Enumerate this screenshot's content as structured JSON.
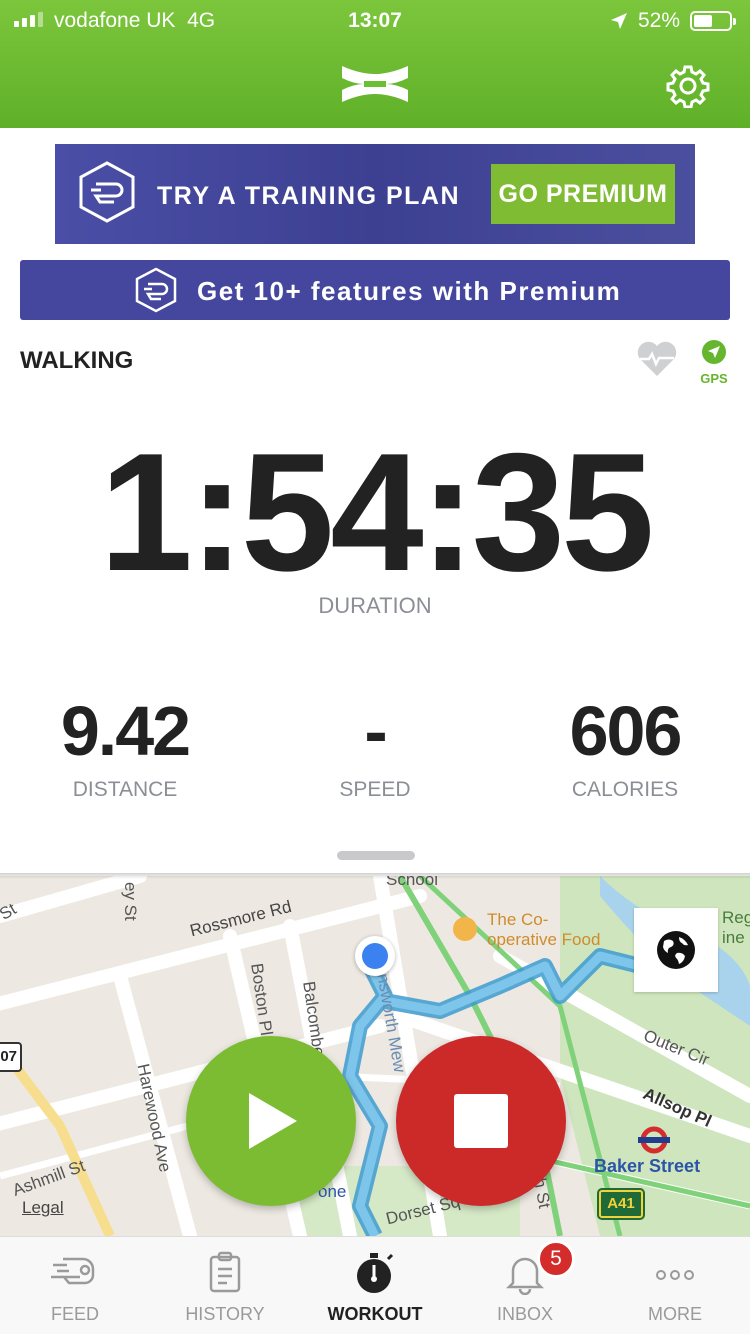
{
  "status_bar": {
    "carrier": "vodafone UK",
    "network": "4G",
    "time": "13:07",
    "battery_pct": "52%",
    "icons": [
      "signal-icon",
      "location-arrow-icon",
      "battery-icon"
    ]
  },
  "header": {
    "logo": "under-armour-logo",
    "settings_icon": "gear-icon",
    "brand_color": "#6abf33"
  },
  "promo_banner": {
    "text": "TRY A TRAINING PLAN",
    "button_label": "GO PREMIUM"
  },
  "features_banner": {
    "text": "Get 10+ features with Premium"
  },
  "workout": {
    "activity": "WALKING",
    "gps_label": "GPS",
    "duration": {
      "value": "1:54:35",
      "label": "DURATION"
    },
    "stats": [
      {
        "value": "9.42",
        "label": "DISTANCE"
      },
      {
        "value": "-",
        "label": "SPEED"
      },
      {
        "value": "606",
        "label": "CALORIES"
      }
    ]
  },
  "map": {
    "labels": {
      "rossmore": "Rossmore Rd",
      "coop_line1": "The Co-",
      "coop_line2": "operative Food",
      "boston": "Boston Pl",
      "balcombe": "Balcombe",
      "harewood": "Harewood Ave",
      "ashmill": "Ashmill St",
      "school": "School",
      "ey_st": "ey St",
      "baker_street": "Baker Street",
      "allsop": "Allsop Pl",
      "outer_cir": "Outer Cir",
      "dorset": "Dorset Sq",
      "mews": "nsworth Mew",
      "th_st": "th St",
      "one": "one",
      "reg": "Reg",
      "ine": "ine",
      "st": "St",
      "legal": "Legal",
      "a41": "A41",
      "b7": "07"
    },
    "route_color": "#5ab4df",
    "play_color": "#7bbc33",
    "stop_color": "#cc2929"
  },
  "tabs": [
    {
      "label": "FEED",
      "icon": "feed-shoe-icon",
      "active": false
    },
    {
      "label": "HISTORY",
      "icon": "clipboard-icon",
      "active": false
    },
    {
      "label": "WORKOUT",
      "icon": "stopwatch-icon",
      "active": true
    },
    {
      "label": "INBOX",
      "icon": "bell-icon",
      "active": false,
      "badge": "5"
    },
    {
      "label": "MORE",
      "icon": "more-dots-icon",
      "active": false
    }
  ]
}
